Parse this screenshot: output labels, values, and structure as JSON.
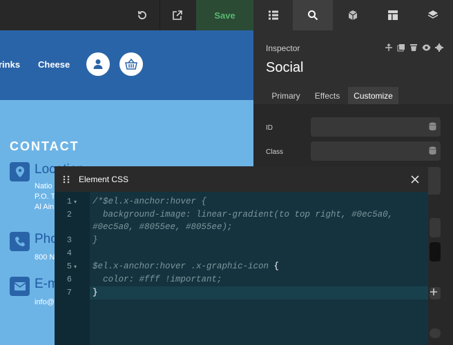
{
  "toolbar": {
    "save_label": "Save",
    "icons": [
      "undo-icon",
      "external-link-icon",
      "list-icon",
      "search-icon",
      "cube-icon",
      "layout-icon",
      "layers-icon"
    ],
    "save_color": "#56b86d"
  },
  "site": {
    "nav": [
      "rinks",
      "Cheese"
    ],
    "contact_title": "CONTACT",
    "location": {
      "heading": "Location",
      "lines": [
        "Natio",
        "P.O. T",
        "Al Ain"
      ]
    },
    "phone": {
      "heading": "Phone",
      "lines": [
        "800 N"
      ]
    },
    "email": {
      "heading": "E-mail",
      "lines": [
        "info@"
      ]
    },
    "header_color": "#2a64a8",
    "body_color": "#6db4e6"
  },
  "inspector": {
    "label": "Inspector",
    "title": "Social",
    "tabs": [
      "Primary",
      "Effects",
      "Customize"
    ],
    "active_tab": "Customize",
    "fields": [
      {
        "label": "ID",
        "value": ""
      },
      {
        "label": "Class",
        "value": ""
      }
    ]
  },
  "editor": {
    "title": "Element CSS",
    "lines": [
      {
        "num": "1",
        "fold": "▾",
        "text": "/*$el.x-anchor:hover {"
      },
      {
        "num": "2",
        "fold": "",
        "text": "  background-image: linear-gradient(to top right, #0ec5a0,"
      },
      {
        "num": "",
        "fold": "",
        "text": "#0ec5a0, #8055ee, #8055ee);"
      },
      {
        "num": "3",
        "fold": "",
        "text": "}"
      },
      {
        "num": "4",
        "fold": "",
        "text": ""
      },
      {
        "num": "5",
        "fold": "▾",
        "text": "$el.x-anchor:hover .x-graphic-icon ",
        "brace": "{"
      },
      {
        "num": "6",
        "fold": "",
        "text": "  color: #fff !important;"
      },
      {
        "num": "7",
        "fold": "",
        "text": "",
        "brace": "}"
      }
    ]
  }
}
